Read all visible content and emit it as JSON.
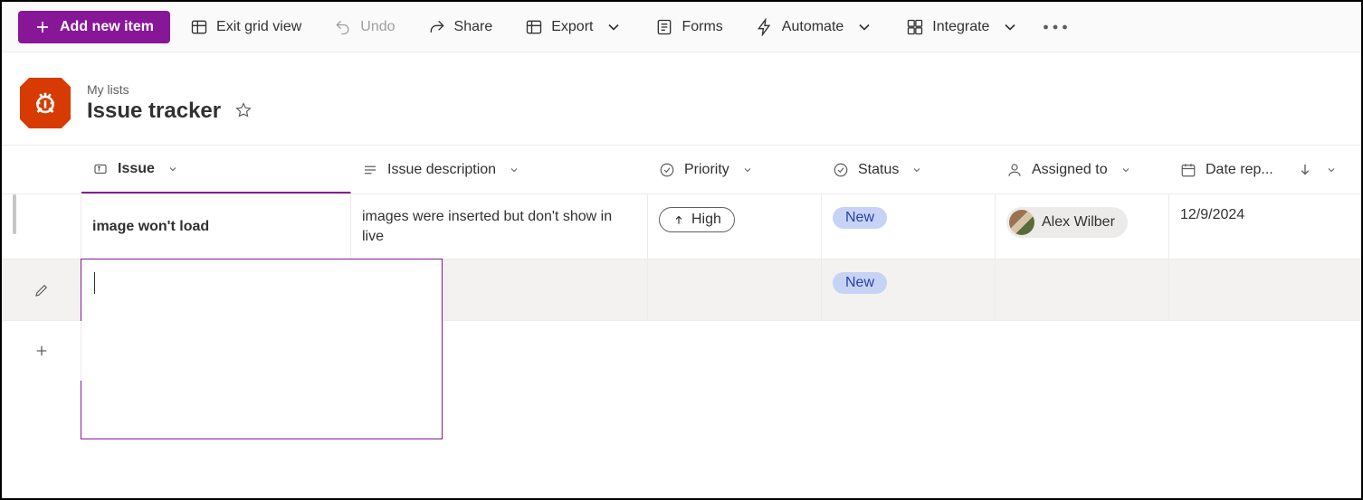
{
  "toolbar": {
    "add_label": "Add new item",
    "exit_grid": "Exit grid view",
    "undo": "Undo",
    "share": "Share",
    "export": "Export",
    "forms": "Forms",
    "automate": "Automate",
    "integrate": "Integrate"
  },
  "breadcrumb": "My lists",
  "title": "Issue tracker",
  "columns": {
    "issue": "Issue",
    "description": "Issue description",
    "priority": "Priority",
    "status": "Status",
    "assigned": "Assigned to",
    "date_reported": "Date rep..."
  },
  "rows": [
    {
      "issue": "image won't load",
      "description": "images were inserted but don't show in live",
      "priority": "High",
      "status": "New",
      "assigned": "Alex Wilber",
      "date": "12/9/2024"
    },
    {
      "issue": "",
      "description": "",
      "priority": "",
      "status": "New",
      "assigned": "",
      "date": ""
    }
  ]
}
